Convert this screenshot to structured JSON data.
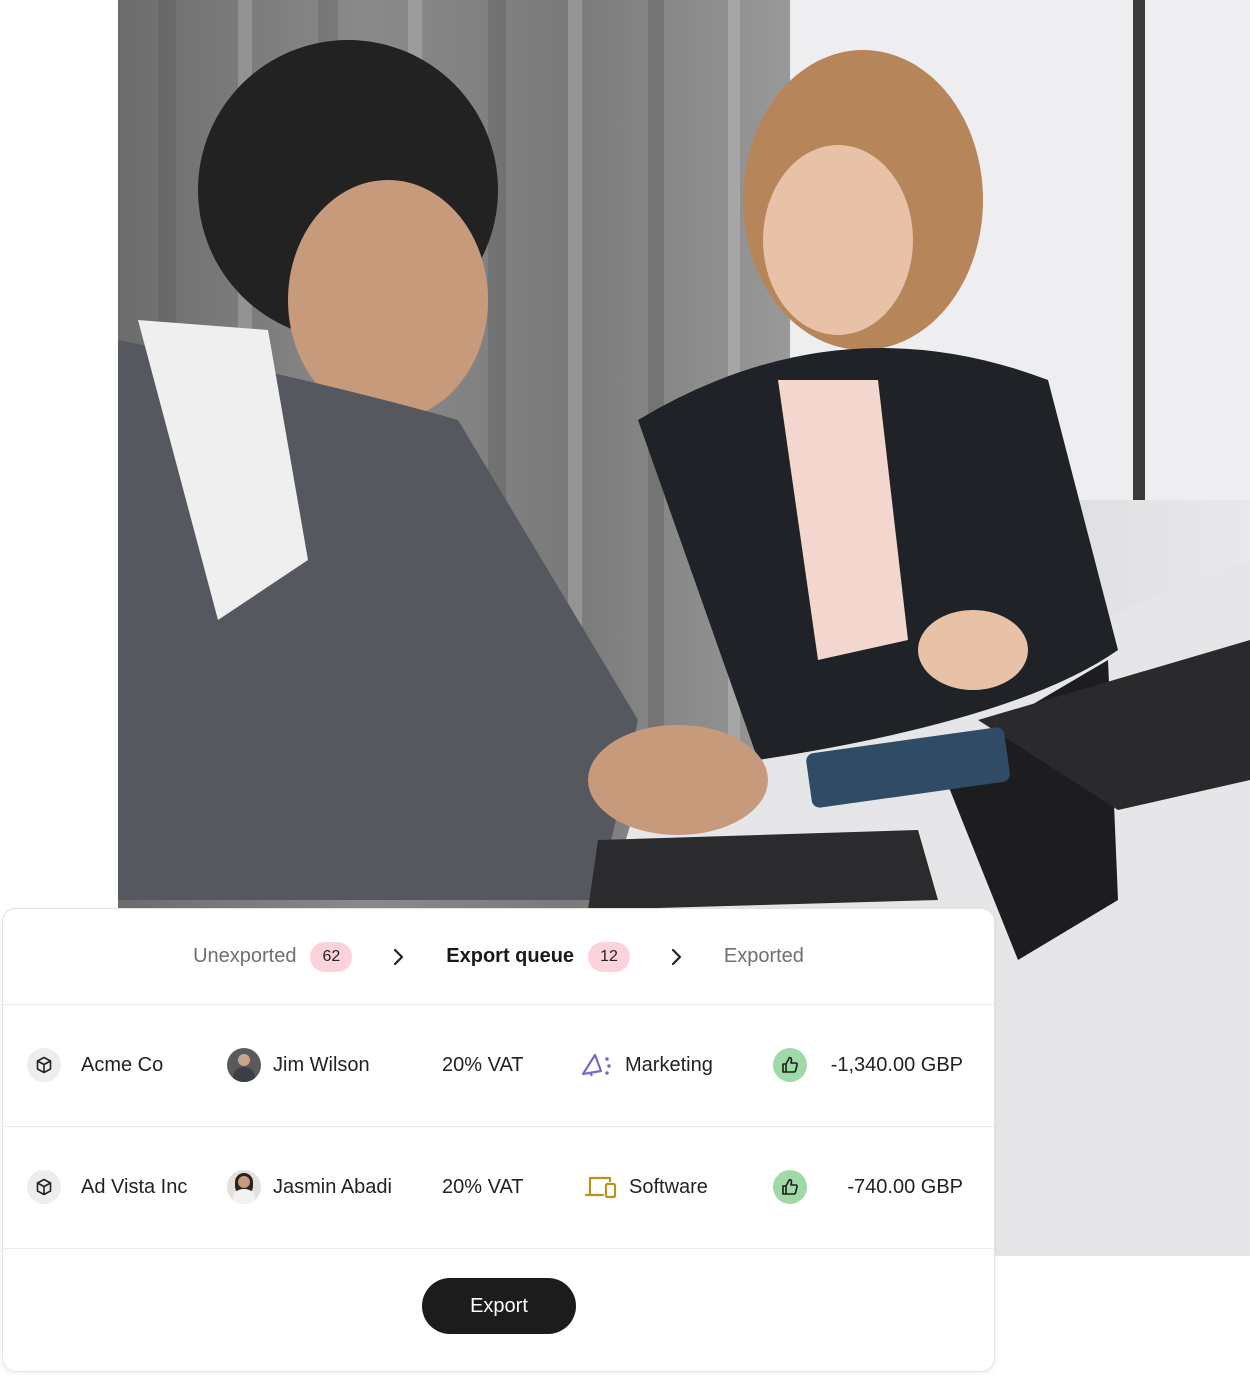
{
  "steps": [
    {
      "label": "Unexported",
      "count": "62",
      "active": false
    },
    {
      "label": "Export queue",
      "count": "12",
      "active": true
    },
    {
      "label": "Exported",
      "count": "",
      "active": false
    }
  ],
  "rows": [
    {
      "company": "Acme Co",
      "person": "Jim Wilson",
      "vat": "20% VAT",
      "category": "Marketing",
      "category_icon": "megaphone-icon",
      "amount": "-1,340.00 GBP",
      "status_icon": "thumbs-up-icon"
    },
    {
      "company": "Ad Vista Inc",
      "person": "Jasmin Abadi",
      "vat": "20% VAT",
      "category": "Software",
      "category_icon": "devices-icon",
      "amount": "-740.00 GBP",
      "status_icon": "thumbs-up-icon"
    }
  ],
  "export_label": "Export",
  "colors": {
    "badge_bg": "#fcd3db",
    "approve_bg": "#9ed9a6",
    "marketing_icon": "#7c69c4",
    "software_icon": "#b7931e",
    "button_bg": "#1c1c1c"
  }
}
